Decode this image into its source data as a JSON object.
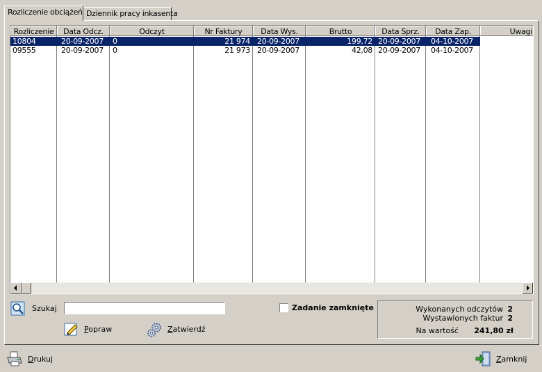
{
  "tabs": [
    {
      "label": "Rozliczenie obciążeń",
      "active": true
    },
    {
      "label": "Dziennik pracy inkasenta",
      "active": false
    }
  ],
  "grid": {
    "columns": [
      "Rozliczenie",
      "Data Odcz.",
      "Odczyt",
      "Nr Faktury",
      "Data Wys.",
      "Brutto",
      "Data Sprz.",
      "Data Zap.",
      "Uwagi"
    ],
    "rows": [
      {
        "cells": [
          "10804",
          "20-09-2007",
          "0",
          "21 974",
          "20-09-2007",
          "199,72",
          "20-09-2007",
          "04-10-2007",
          ""
        ],
        "selected": true
      },
      {
        "cells": [
          "09555",
          "20-09-2007",
          "0",
          "21 973",
          "20-09-2007",
          "42,08",
          "20-09-2007",
          "04-10-2007",
          ""
        ],
        "selected": false
      }
    ]
  },
  "search": {
    "label": "Szukaj",
    "value": ""
  },
  "checkbox": {
    "label": "Zadanie zamknięte",
    "checked": false
  },
  "buttons": {
    "popraw": {
      "first": "P",
      "rest": "opraw"
    },
    "zatwierdz": {
      "first": "Z",
      "rest": "atwierdź"
    },
    "drukuj": {
      "first": "D",
      "rest": "rukuj"
    },
    "zamknij": {
      "first": "Z",
      "rest": "amknij"
    }
  },
  "stats": {
    "readings_label": "Wykonanych odczytów",
    "readings_value": "2",
    "invoices_label": "Wystawionych faktur",
    "invoices_value": "2",
    "amount_label": "Na wartość",
    "amount_value": "241,80 zł"
  },
  "colors": {
    "selection": "#0a246a",
    "window": "#d4d0c8"
  }
}
